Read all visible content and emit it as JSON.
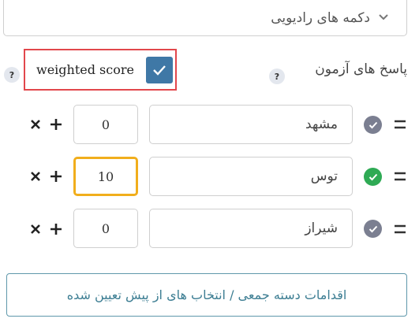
{
  "dropdown": {
    "value": "دکمه های رادیویی",
    "icon": "chevron-down-icon"
  },
  "answers": {
    "label": "پاسخ های آزمون",
    "help_text": "?",
    "weighted_label": "weighted score",
    "weighted_checked": true,
    "weighted_help_text": "?"
  },
  "options": [
    {
      "text": "مشهد",
      "score": "0",
      "correct": false
    },
    {
      "text": "توس",
      "score": "10",
      "correct": true
    },
    {
      "text": "شیراز",
      "score": "0",
      "correct": false
    }
  ],
  "bulk_button": {
    "label": "اقدامات دسته جمعی / انتخاب های از پیش تعیین شده"
  },
  "colors": {
    "checkbox": "#3f78a6",
    "highlight_border": "#e2474c",
    "focus_border": "#f1ae1c",
    "correct": "#2eaa54",
    "incorrect": "#7b7f91",
    "button_text": "#3d7e93"
  }
}
